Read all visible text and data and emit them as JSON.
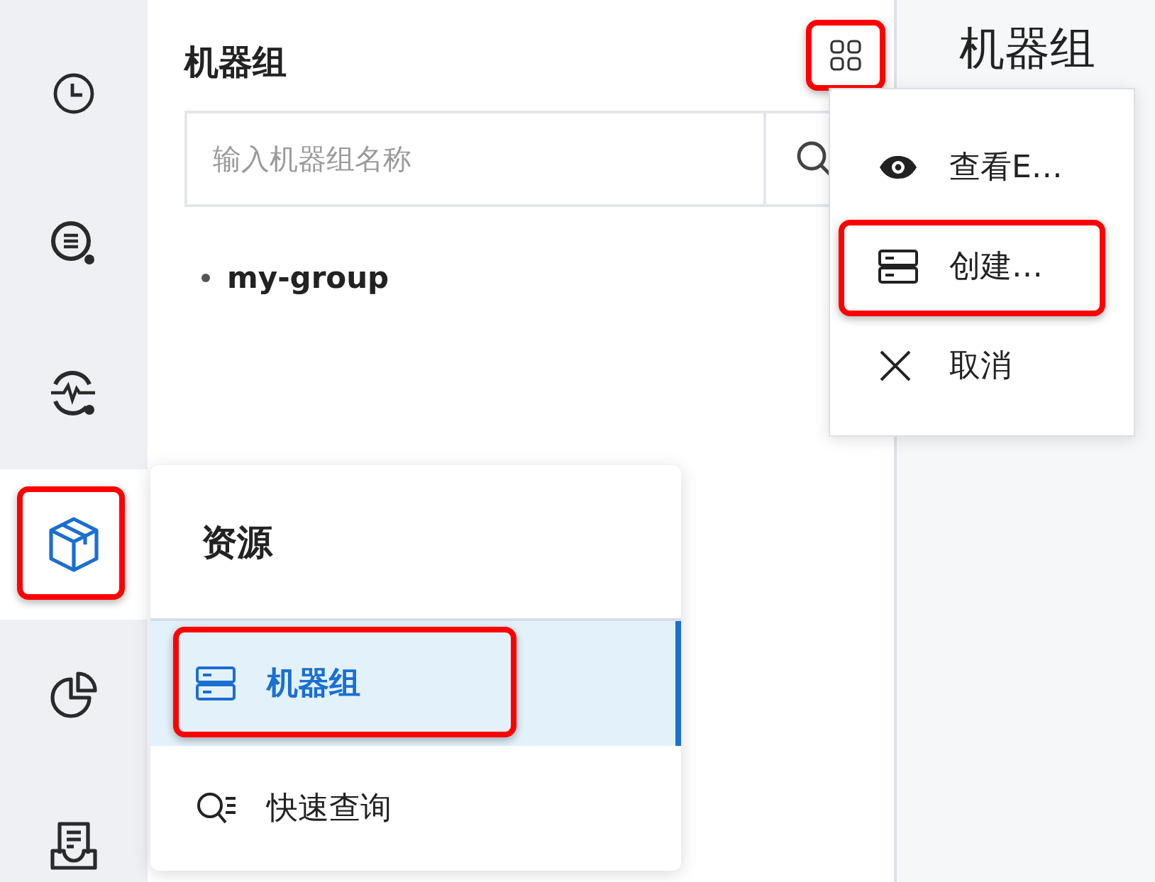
{
  "sidebar": {
    "items": [
      {
        "kind": "clock",
        "selected": false,
        "highlighted": false
      },
      {
        "kind": "search-list",
        "selected": false,
        "highlighted": false
      },
      {
        "kind": "pulse",
        "selected": false,
        "highlighted": false
      },
      {
        "kind": "box",
        "selected": true,
        "highlighted": true
      },
      {
        "kind": "pie",
        "selected": false,
        "highlighted": false
      },
      {
        "kind": "inbox",
        "selected": false,
        "highlighted": false
      }
    ]
  },
  "panel": {
    "title": "机器组",
    "menu_button": {
      "highlighted": true
    },
    "search": {
      "placeholder": "输入机器组名称"
    },
    "tree": [
      {
        "label": "my-group"
      }
    ]
  },
  "main": {
    "title": "机器组"
  },
  "action_menu": {
    "items": [
      {
        "kind": "eye",
        "label": "查看E…",
        "highlighted": false
      },
      {
        "kind": "server",
        "label": "创建…",
        "highlighted": true
      },
      {
        "kind": "close",
        "label": "取消",
        "highlighted": false
      }
    ]
  },
  "flyout": {
    "title": "资源",
    "items": [
      {
        "kind": "server",
        "label": "机器组",
        "selected": true,
        "highlighted": true
      },
      {
        "kind": "query",
        "label": "快速查询",
        "selected": false,
        "highlighted": false
      }
    ]
  }
}
